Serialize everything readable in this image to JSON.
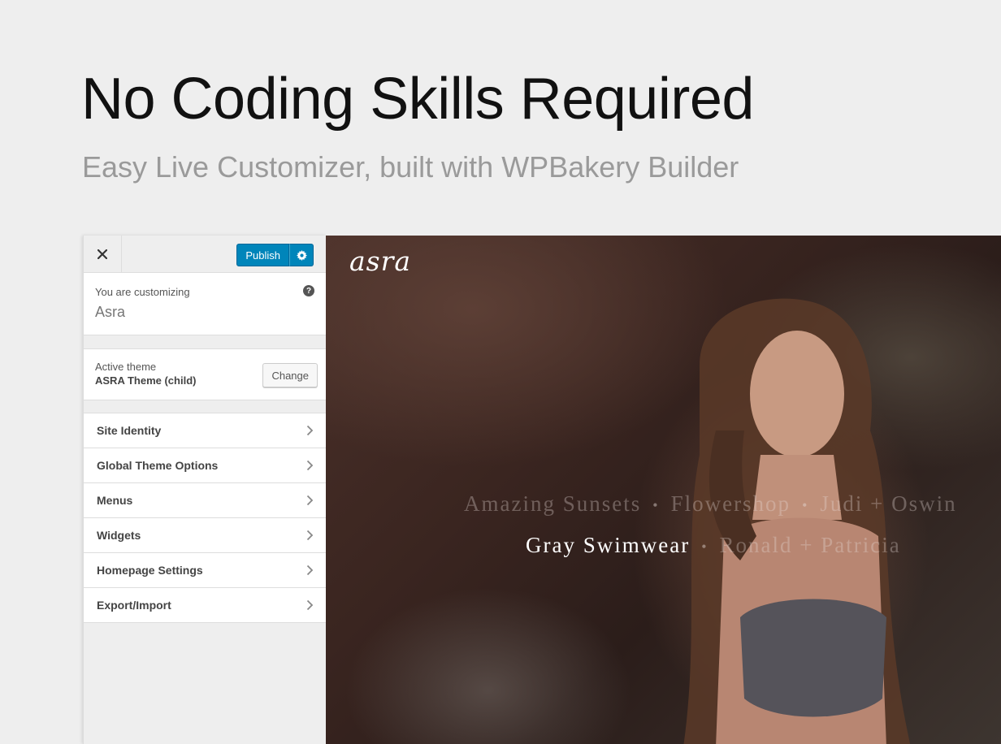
{
  "hero": {
    "title": "No Coding Skills Required",
    "subtitle": "Easy Live Customizer, built with WPBakery Builder"
  },
  "customizer": {
    "publish_label": "Publish",
    "customizing_label": "You are customizing",
    "site_name": "Asra",
    "help_glyph": "?",
    "active_theme_label": "Active theme",
    "active_theme_name": "ASRA Theme (child)",
    "change_label": "Change",
    "sections": [
      {
        "label": "Site Identity"
      },
      {
        "label": "Global Theme Options"
      },
      {
        "label": "Menus"
      },
      {
        "label": "Widgets"
      },
      {
        "label": "Homepage Settings"
      },
      {
        "label": "Export/Import"
      }
    ],
    "icons": {
      "close": "close-icon",
      "gear": "gear-icon",
      "help": "help-icon",
      "chevron": "chevron-right-icon"
    },
    "colors": {
      "publish_bg": "#0085ba",
      "panel_bg": "#eeeeee"
    }
  },
  "preview": {
    "brand": "asra",
    "nav_row1": [
      "Amazing Sunsets",
      "Flowershop",
      "Judi + Oswin"
    ],
    "nav_row2": [
      "Gray Swimwear",
      "Ronald + Patricia"
    ],
    "separator": "•"
  }
}
